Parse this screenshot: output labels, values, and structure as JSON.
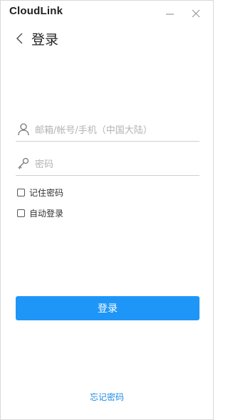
{
  "app": {
    "title": "CloudLink"
  },
  "window_controls": {
    "minimize_icon": "minimize-icon",
    "close_icon": "close-icon"
  },
  "header": {
    "back_icon": "chevron-left-icon",
    "title": "登录"
  },
  "form": {
    "account": {
      "icon": "user-icon",
      "value": "",
      "placeholder": "邮箱/帐号/手机（中国大陆）"
    },
    "password": {
      "icon": "key-icon",
      "value": "",
      "placeholder": "密码"
    },
    "remember_password": {
      "label": "记住密码",
      "checked": false
    },
    "auto_login": {
      "label": "自动登录",
      "checked": false
    },
    "submit_label": "登录"
  },
  "footer": {
    "forgot_password_label": "忘记密码"
  },
  "colors": {
    "primary": "#1e96f8",
    "link": "#1e8ce6",
    "placeholder": "#b3b3b3",
    "divider": "#cfcfcf"
  }
}
